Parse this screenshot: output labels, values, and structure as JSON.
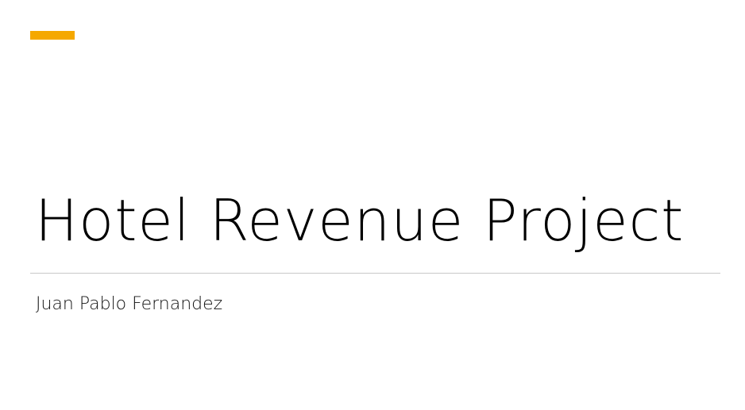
{
  "slide": {
    "title": "Hotel Revenue Project",
    "subtitle": "Juan Pablo Fernandez",
    "accent_color": "#f5a800",
    "divider_color": "#c8c8c8"
  }
}
